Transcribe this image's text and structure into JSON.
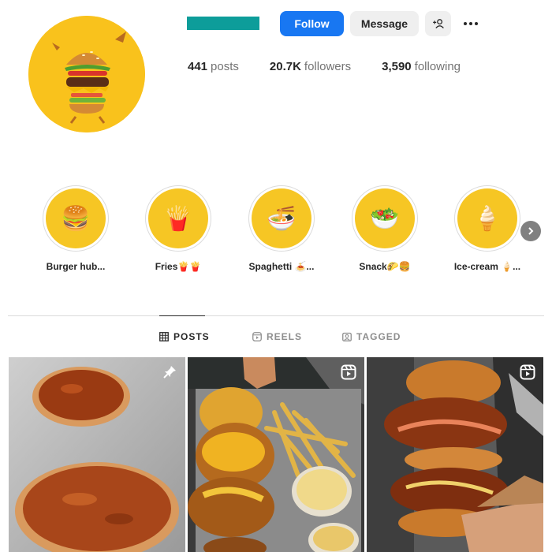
{
  "profile": {
    "avatar_icon": "burger-avatar",
    "brand_color": "#0d9d9a",
    "accent_yellow": "#f9c21c"
  },
  "actions": {
    "follow_label": "Follow",
    "message_label": "Message",
    "add_user_icon": "person-plus-icon",
    "more_icon": "ellipsis-icon",
    "follow_color": "#1877f2"
  },
  "stats": [
    {
      "value": "441",
      "label": "posts"
    },
    {
      "value": "20.7K",
      "label": "followers"
    },
    {
      "value": "3,590",
      "label": "following"
    }
  ],
  "highlights": [
    {
      "label": "Burger hub...",
      "emoji": "🍔"
    },
    {
      "label": "Fries🍟🍟",
      "emoji": "🍟"
    },
    {
      "label": "Spaghetti 🍝...",
      "emoji": "🍜"
    },
    {
      "label": "Snack🌮🍔",
      "emoji": "🥗"
    },
    {
      "label": "Ice-cream 🍦...",
      "emoji": "🍦"
    }
  ],
  "tabs": [
    {
      "label": "POSTS",
      "icon": "grid-icon",
      "active": true
    },
    {
      "label": "REELS",
      "icon": "reels-icon",
      "active": false
    },
    {
      "label": "TAGGED",
      "icon": "tagged-icon",
      "active": false
    }
  ],
  "posts": [
    {
      "subject": "glazed-buns",
      "badge": "pin-icon"
    },
    {
      "subject": "chicken-sandwich-fries",
      "badge": "reel-icon"
    },
    {
      "subject": "stacked-fried-chicken-burger",
      "badge": "reel-icon"
    }
  ]
}
